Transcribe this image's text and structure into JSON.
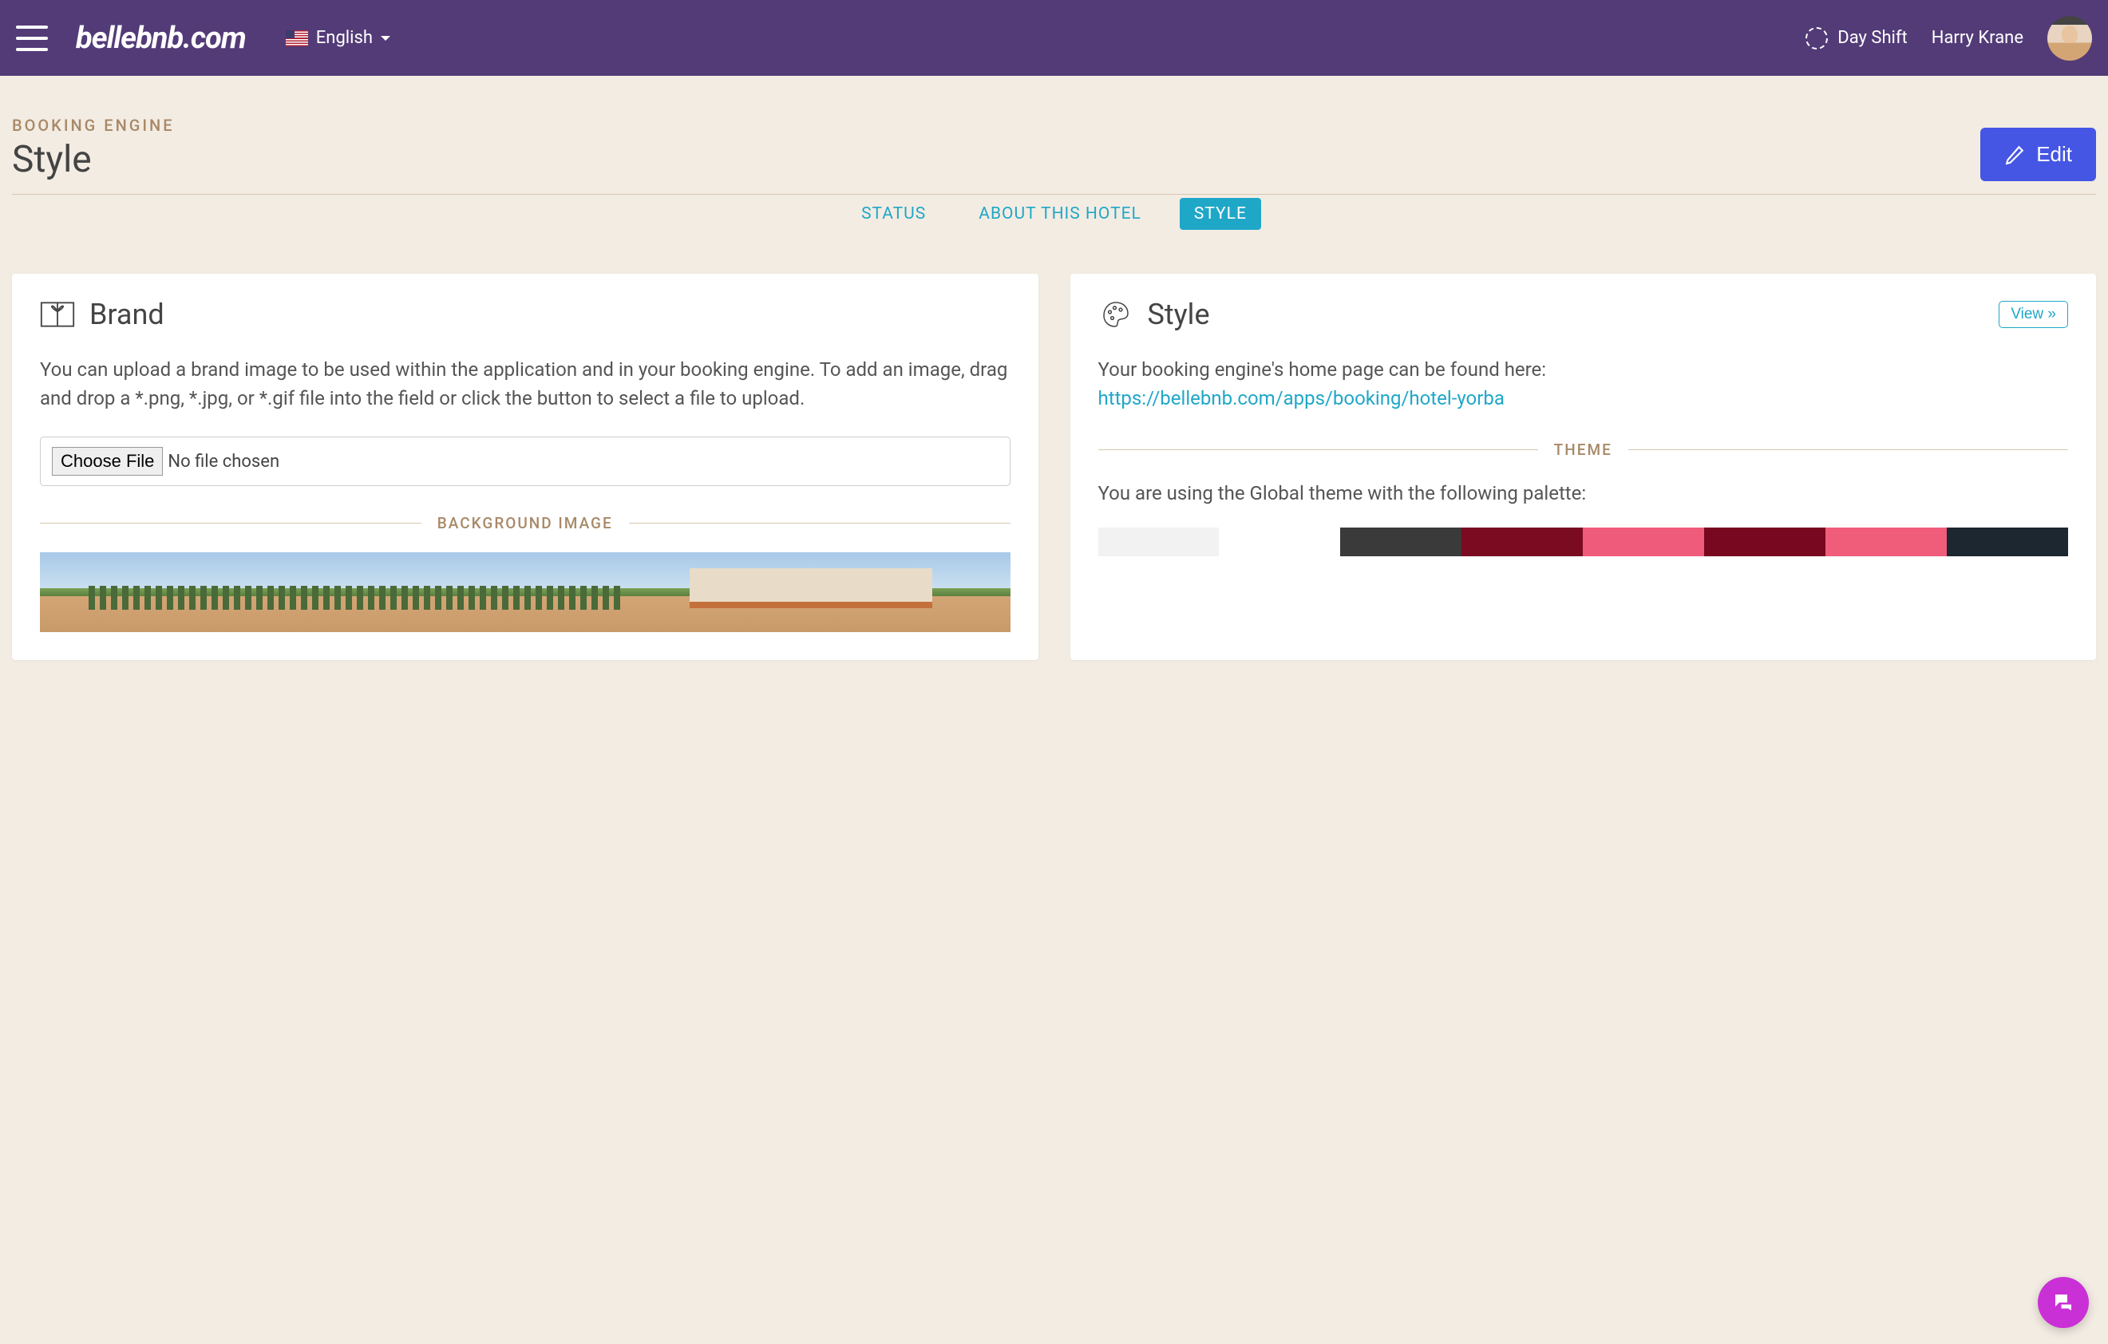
{
  "header": {
    "logo_text": "bellebnb.com",
    "language": "English",
    "shift_label": "Day Shift",
    "user_name": "Harry Krane"
  },
  "page": {
    "breadcrumb": "BOOKING ENGINE",
    "title": "Style",
    "edit_label": "Edit"
  },
  "tabs": [
    {
      "label": "STATUS",
      "active": false
    },
    {
      "label": "ABOUT THIS HOTEL",
      "active": false
    },
    {
      "label": "STYLE",
      "active": true
    }
  ],
  "brand_panel": {
    "title": "Brand",
    "description": "You can upload a brand image to be used within the application and in your booking engine. To add an image, drag and drop a *.png, *.jpg, or *.gif file into the field or click the button to select a file to upload.",
    "choose_file_label": "Choose File",
    "file_status": "No file chosen",
    "bg_image_label": "BACKGROUND IMAGE"
  },
  "style_panel": {
    "title": "Style",
    "view_label": "View »",
    "intro_text": "Your booking engine's home page can be found here:",
    "booking_url": "https://bellebnb.com/apps/booking/hotel-yorba",
    "theme_label": "THEME",
    "theme_description": "You are using the Global theme with the following palette:",
    "palette": [
      "#f2f2f2",
      "#ffffff",
      "#3a3a3a",
      "#7a0b21",
      "#ef5b7a",
      "#77081f",
      "#ef5d7b",
      "#1c2730"
    ]
  }
}
